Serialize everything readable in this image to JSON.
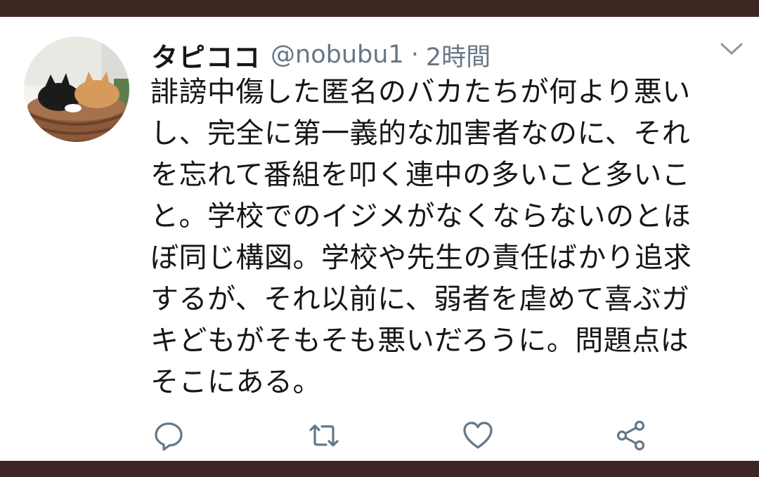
{
  "tweet": {
    "author_name": "タピココ",
    "handle": "@nobubu1",
    "separator": "·",
    "time": "2時間",
    "text_lines": [
      "誹謗中傷した匿名のバカたちが何より悪い",
      "し、完全に第一義的な加害者なのに、それ",
      "を忘れて番組を叩く連中の多いこと多いこ",
      "と。学校でのイジメがなくならないのとほ",
      "ぼ同じ構図。学校や先生の責任ばかり追求",
      "するが、それ以前に、弱者を虐めて喜ぶガ",
      "キどもがそもそも悪いだろうに。問題点は",
      "そこにある。"
    ]
  },
  "icons": {
    "menu": "chevron-down-icon",
    "reply": "reply-icon",
    "retweet": "retweet-icon",
    "like": "heart-icon",
    "share": "share-icon"
  },
  "colors": {
    "frame": "#3e2723",
    "card": "#ffffff",
    "text": "#14171a",
    "secondary": "#657786"
  }
}
